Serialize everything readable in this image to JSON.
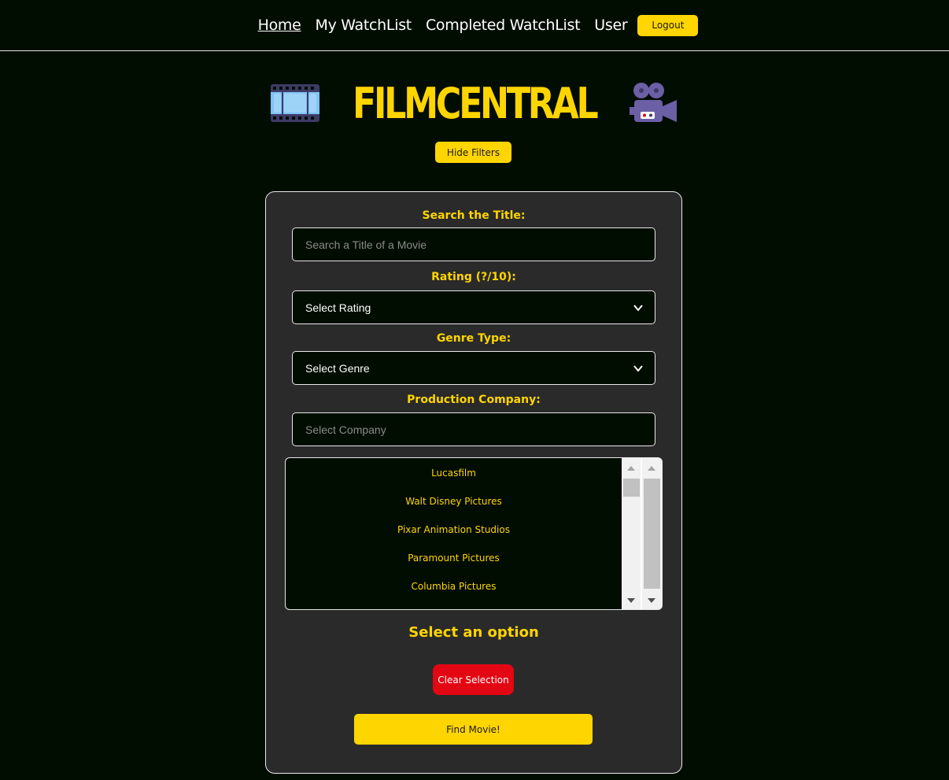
{
  "nav": {
    "home": "Home",
    "my_watchlist": "My WatchList",
    "completed_watchlist": "Completed WatchList",
    "user": "User",
    "logout": "Logout"
  },
  "brand": {
    "title": "FILMCENTRAL",
    "left_icon": "film-frames-icon",
    "right_icon": "movie-camera-icon"
  },
  "filters_toggle": "Hide Filters",
  "form": {
    "title_label": "Search the Title:",
    "title_placeholder": "Search a Title of a Movie",
    "rating_label": "Rating (?/10):",
    "rating_selected": "Select Rating",
    "genre_label": "Genre Type:",
    "genre_selected": "Select Genre",
    "company_label": "Production Company:",
    "company_placeholder": "Select Company",
    "companies": [
      "Lucasfilm",
      "Walt Disney Pictures",
      "Pixar Animation Studios",
      "Paramount Pictures",
      "Columbia Pictures"
    ],
    "selection_status": "Select an option",
    "clear_label": "Clear Selection",
    "find_label": "Find Movie!"
  },
  "colors": {
    "accent": "#ffd500",
    "background": "#020d02",
    "panel": "#2a2a2a",
    "danger": "#e30613"
  }
}
